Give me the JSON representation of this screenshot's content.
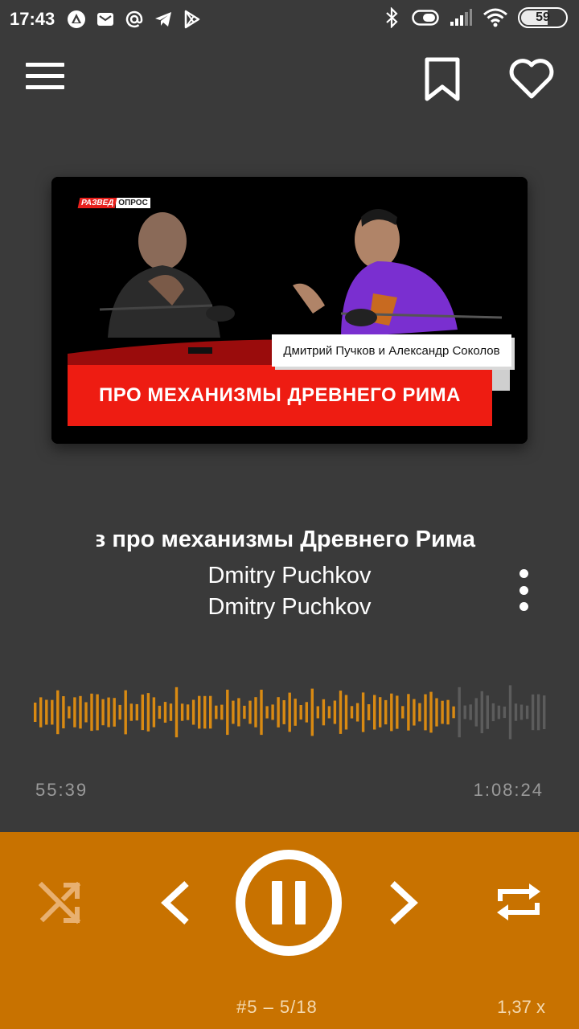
{
  "status_bar": {
    "time": "17:43",
    "left_icons": [
      "app-a-icon",
      "mail-icon",
      "at-sign-icon",
      "telegram-icon",
      "play-store-icon"
    ],
    "right_icons": [
      "bluetooth-icon",
      "toggle-icon",
      "signal-icon",
      "wifi-icon"
    ],
    "battery": "59"
  },
  "toolbar": {
    "menu_icon": "hamburger-menu-icon",
    "bookmark_icon": "bookmark-icon",
    "favorite_icon": "heart-icon"
  },
  "cover": {
    "logo_part1": "РАЗВЕД",
    "logo_part2": "ОПРОС",
    "caption": "Дмитрий Пучков и Александр Соколов",
    "banner": "ПРО МЕХАНИЗМЫ ДРЕВНЕГО РИМА"
  },
  "track": {
    "title": "Соколов про механизмы Древнего Рима",
    "artist": "Dmitry Puchkov",
    "album": "Dmitry Puchkov",
    "more_icon": "more-vertical-icon"
  },
  "progress": {
    "current": "55:39",
    "total": "1:08:24",
    "fraction": 0.8136,
    "played_color": "#d98a12",
    "remaining_color": "#5c5c5c"
  },
  "controls": {
    "background": "#c87200",
    "shuffle_icon": "shuffle-icon",
    "prev_icon": "chevron-left-icon",
    "play_pause_icon": "pause-icon",
    "next_icon": "chevron-right-icon",
    "repeat_icon": "repeat-icon",
    "track_position": "#5  –  5/18",
    "speed": "1,37 x"
  }
}
